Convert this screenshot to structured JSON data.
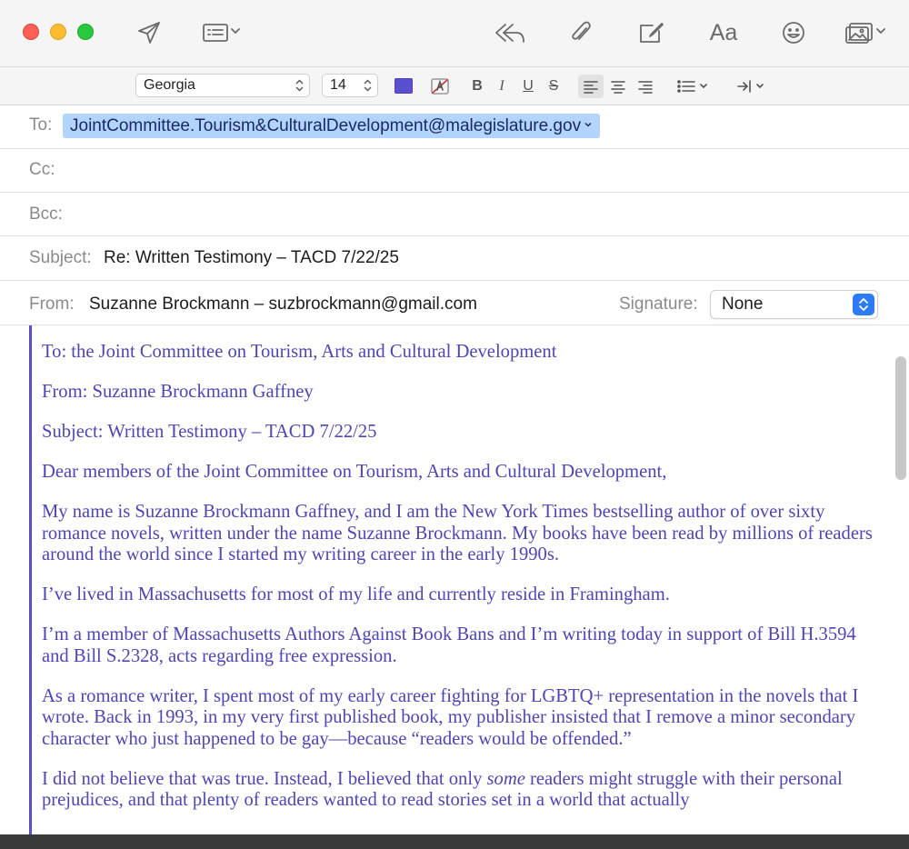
{
  "toolbar": {
    "icons": [
      "send-icon",
      "header-fields-icon",
      "reply-all-icon",
      "attach-icon",
      "markup-icon",
      "fonts-icon",
      "emoji-icon",
      "photo-browser-icon"
    ],
    "fonts_label": "Aa"
  },
  "format_bar": {
    "font_family": "Georgia",
    "font_size": "14",
    "text_color": "#5a4fcf",
    "bold": "B",
    "italic": "I",
    "underline": "U",
    "strikethrough": "S",
    "alignment": "left"
  },
  "header": {
    "to_label": "To:",
    "to_value": "JointCommittee.Tourism&CulturalDevelopment@malegislature.gov",
    "cc_label": "Cc:",
    "bcc_label": "Bcc:",
    "subject_label": "Subject:",
    "subject_value": "Re: Written Testimony – TACD 7/22/25",
    "from_label": "From:",
    "from_value": "Suzanne Brockmann – suzbrockmann@gmail.com",
    "signature_label": "Signature:",
    "signature_value": "None"
  },
  "body": {
    "p1": "To: the Joint Committee on Tourism, Arts and Cultural Development",
    "p2": "From: Suzanne Brockmann Gaffney",
    "p3": "Subject: Written Testimony – TACD 7/22/25",
    "p4": "Dear members of the Joint Committee on Tourism, Arts and Cultural Development,",
    "p5": "My name is Suzanne Brockmann Gaffney, and I am the New York Times bestselling author of over sixty romance novels, written under the name Suzanne Brockmann. My books have been read by millions of readers around the world since I started my writing career in the early 1990s.",
    "p6": "I’ve lived in Massachusetts for most of my life and currently reside in Framingham.",
    "p7": "I’m a member of Massachusetts Authors Against Book Bans and I’m writing today in support of Bill H.3594 and Bill S.2328, acts regarding free expression.",
    "p8": "As a romance writer, I spent most of my early career fighting for LGBTQ+ representation in the novels that I wrote. Back in 1993, in my very first published book, my publisher insisted that I remove a minor secondary character who just happened to be gay—because “readers would be offended.”",
    "p9_a": "I did not believe that was true. Instead, I believed that only ",
    "p9_em": "some",
    "p9_b": " readers might struggle with their personal prejudices, and that plenty of readers wanted to read stories set in a world that actually"
  }
}
